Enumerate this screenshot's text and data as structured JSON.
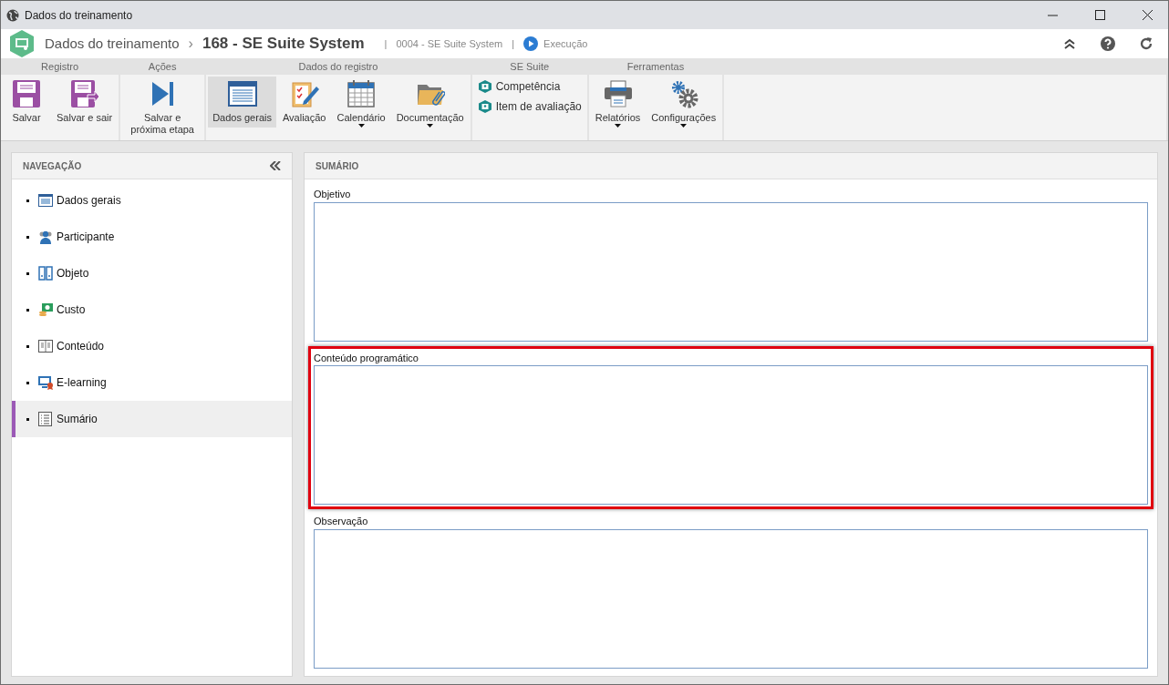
{
  "window": {
    "title": "Dados do treinamento"
  },
  "header": {
    "module": "Dados do treinamento",
    "separator": "›",
    "record": "168 - SE Suite System",
    "divider_1": "|",
    "code": "0004 - SE Suite System",
    "divider_2": "|",
    "status": "Execução"
  },
  "ribbon": {
    "groups": [
      {
        "title": "Registro",
        "buttons": [
          {
            "kind": "large",
            "label": "Salvar",
            "dropdown": false,
            "selected": false
          },
          {
            "kind": "large",
            "label": "Salvar e sair",
            "dropdown": false,
            "selected": false
          }
        ]
      },
      {
        "title": "Ações",
        "buttons": [
          {
            "kind": "large",
            "label": "Salvar e próxima etapa",
            "dropdown": false,
            "selected": false
          }
        ]
      },
      {
        "title": "Dados do registro",
        "buttons": [
          {
            "kind": "large",
            "label": "Dados gerais",
            "dropdown": false,
            "selected": true
          },
          {
            "kind": "large",
            "label": "Avaliação",
            "dropdown": false,
            "selected": false
          },
          {
            "kind": "large",
            "label": "Calendário",
            "dropdown": true,
            "selected": false
          },
          {
            "kind": "large",
            "label": "Documentação",
            "dropdown": true,
            "selected": false
          }
        ]
      },
      {
        "title": "SE Suite",
        "buttons": [
          {
            "kind": "small",
            "label": "Competência",
            "selected": false
          },
          {
            "kind": "small",
            "label": "Item de avaliação",
            "selected": false
          }
        ]
      },
      {
        "title": "Ferramentas",
        "buttons": [
          {
            "kind": "large",
            "label": "Relatórios",
            "dropdown": true,
            "selected": false
          },
          {
            "kind": "large",
            "label": "Configurações",
            "dropdown": true,
            "selected": false
          }
        ]
      }
    ]
  },
  "navigation": {
    "title": "NAVEGAÇÃO",
    "items": [
      {
        "label": "Dados gerais",
        "selected": false
      },
      {
        "label": "Participante",
        "selected": false
      },
      {
        "label": "Objeto",
        "selected": false
      },
      {
        "label": "Custo",
        "selected": false
      },
      {
        "label": "Conteúdo",
        "selected": false
      },
      {
        "label": "E-learning",
        "selected": false
      },
      {
        "label": "Sumário",
        "selected": true
      }
    ]
  },
  "summary": {
    "title": "SUMÁRIO",
    "fields": [
      {
        "label": "Objetivo",
        "highlighted": false
      },
      {
        "label": "Conteúdo programático",
        "highlighted": true
      },
      {
        "label": "Observação",
        "highlighted": false
      }
    ]
  }
}
